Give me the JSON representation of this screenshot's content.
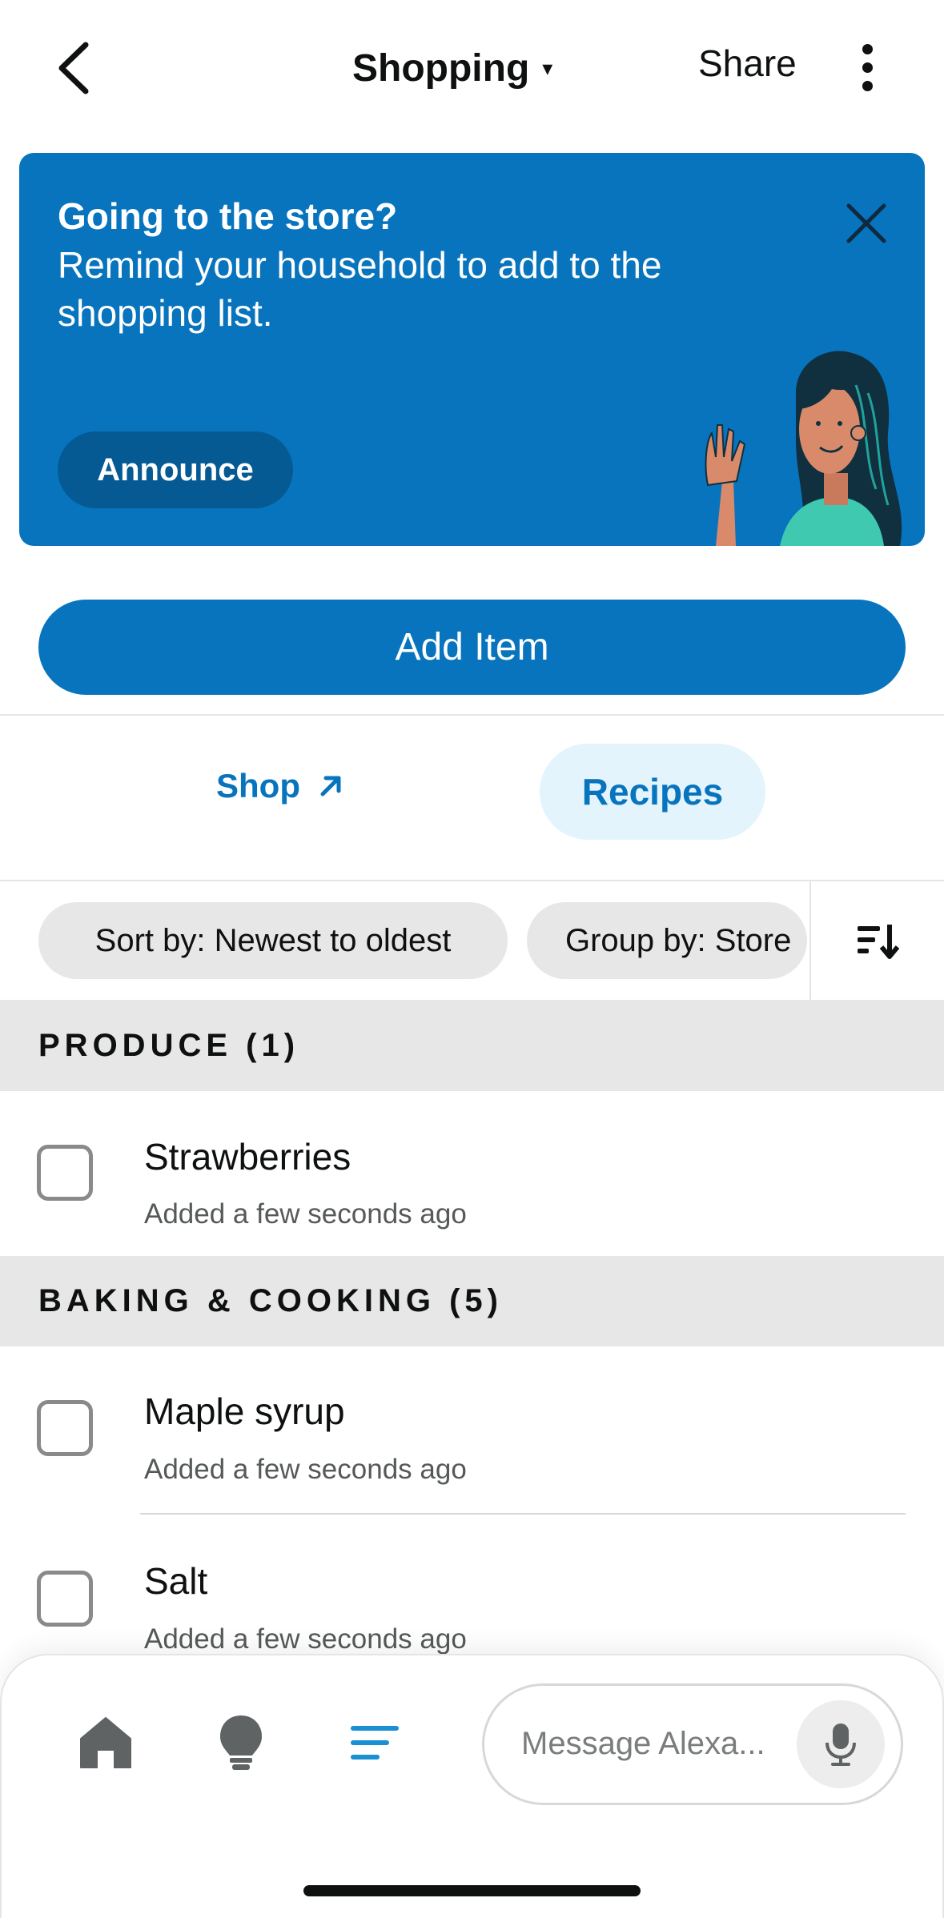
{
  "header": {
    "title": "Shopping",
    "caret": "▾",
    "share_label": "Share"
  },
  "banner": {
    "title": "Going to the store?",
    "body": "Remind your household to add to the shopping list.",
    "announce_label": "Announce"
  },
  "add_item_label": "Add Item",
  "links": {
    "shop_label": "Shop",
    "recipes_label": "Recipes"
  },
  "filters": {
    "sort_label": "Sort by: Newest to oldest",
    "group_label": "Group by: Store"
  },
  "sections": [
    {
      "title": "PRODUCE (1)",
      "items": [
        {
          "name": "Strawberries",
          "added": "Added a few seconds ago"
        }
      ]
    },
    {
      "title": "BAKING & COOKING (5)",
      "items": [
        {
          "name": "Maple syrup",
          "added": "Added a few seconds ago"
        },
        {
          "name": "Salt",
          "added": "Added a few seconds ago"
        }
      ]
    }
  ],
  "bottom_nav": {
    "items": [
      {
        "icon": "home-icon"
      },
      {
        "icon": "lightbulb-icon"
      },
      {
        "icon": "list-icon"
      }
    ],
    "message_placeholder": "Message Alexa..."
  },
  "colors": {
    "brand_blue": "#0774bd",
    "announce_bg": "#055a93",
    "recipes_bg": "#e3f4fc",
    "section_bg": "#e7e7e7",
    "active_nav": "#1a8fd1",
    "inactive_nav": "#5f6363"
  }
}
